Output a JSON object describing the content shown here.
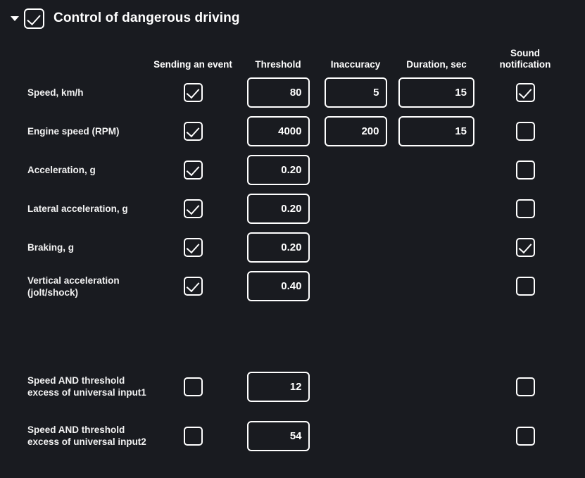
{
  "section": {
    "title": "Control of dangerous driving",
    "expanded": true,
    "enabled": true,
    "collapse_icon": "chevron-down-icon"
  },
  "table": {
    "headers": {
      "parameter": "",
      "sending_event": "Sending an event",
      "threshold": "Threshold",
      "inaccuracy": "Inaccuracy",
      "duration": "Duration, sec",
      "sound_notification_line1": "Sound",
      "sound_notification_line2": "notification"
    },
    "rows": [
      {
        "label": "Speed, km/h",
        "sending_event": true,
        "threshold": "80",
        "inaccuracy": "5",
        "duration": "15",
        "sound": true
      },
      {
        "label": "Engine speed (RPM)",
        "sending_event": true,
        "threshold": "4000",
        "inaccuracy": "200",
        "duration": "15",
        "sound": false
      },
      {
        "label": "Acceleration, g",
        "sending_event": true,
        "threshold": "0.20",
        "inaccuracy": null,
        "duration": null,
        "sound": false
      },
      {
        "label": "Lateral acceleration, g",
        "sending_event": true,
        "threshold": "0.20",
        "inaccuracy": null,
        "duration": null,
        "sound": false
      },
      {
        "label": "Braking, g",
        "sending_event": true,
        "threshold": "0.20",
        "inaccuracy": null,
        "duration": null,
        "sound": true
      },
      {
        "label": "Vertical acceleration (jolt/shock)",
        "sending_event": true,
        "threshold": "0.40",
        "inaccuracy": null,
        "duration": null,
        "sound": false
      }
    ],
    "extra_rows": [
      {
        "label": "Speed AND threshold excess of universal input1",
        "sending_event": false,
        "threshold": "12",
        "inaccuracy": null,
        "duration": null,
        "sound": false
      },
      {
        "label": "Speed AND threshold excess of universal input2",
        "sending_event": false,
        "threshold": "54",
        "inaccuracy": null,
        "duration": null,
        "sound": false
      }
    ]
  },
  "colors": {
    "background": "#191b20",
    "foreground": "#ffffff",
    "border": "#ffffff"
  }
}
